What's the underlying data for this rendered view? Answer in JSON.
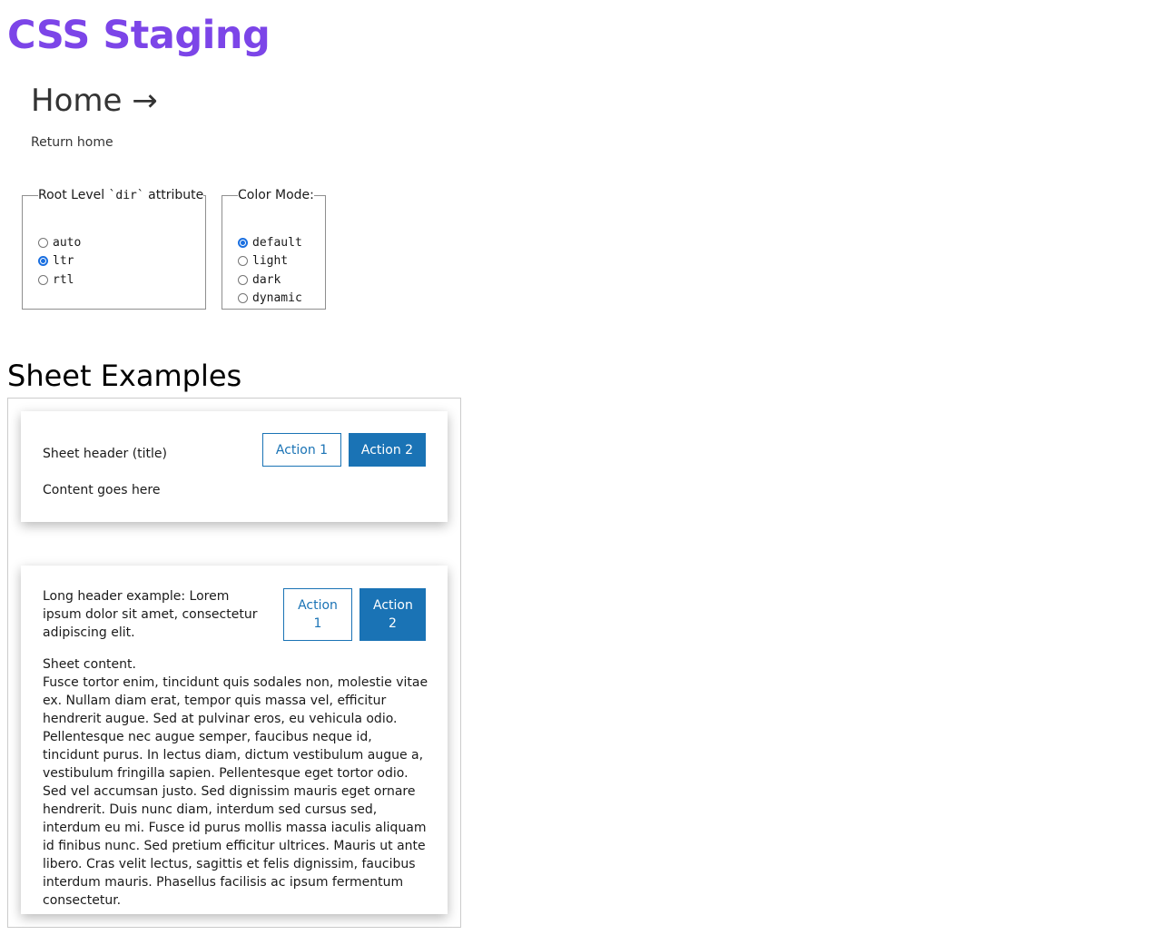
{
  "site": {
    "title": "CSS Staging"
  },
  "nav": {
    "heading": "Home →",
    "return_link": "Return home"
  },
  "dir_fieldset": {
    "legend_prefix": "Root Level ",
    "legend_code": "`dir`",
    "legend_suffix": " attribute",
    "options": [
      "auto",
      "ltr",
      "rtl"
    ],
    "selected": "ltr"
  },
  "color_fieldset": {
    "legend": "Color Mode:",
    "options": [
      "default",
      "light",
      "dark",
      "dynamic"
    ],
    "selected": "default"
  },
  "section": {
    "heading": "Sheet Examples"
  },
  "sheet1": {
    "title": "Sheet header (title)",
    "action1": "Action 1",
    "action2": "Action 2",
    "content": "Content goes here"
  },
  "sheet2": {
    "title": "Long header example: Lorem ipsum dolor sit amet, consectetur adipiscing elit.",
    "action1": "Action 1",
    "action2": "Action 2",
    "content_heading": "Sheet content.",
    "content_body": "Fusce tortor enim, tincidunt quis sodales non, molestie vitae ex. Nullam diam erat, tempor quis massa vel, efficitur hendrerit augue. Sed at pulvinar eros, eu vehicula odio. Pellentesque nec augue semper, faucibus neque id, tincidunt purus. In lectus diam, dictum vestibulum augue a, vestibulum fringilla sapien. Pellentesque eget tortor odio. Sed vel accumsan justo. Sed dignissim mauris eget ornare hendrerit. Duis nunc diam, interdum sed cursus sed, interdum eu mi. Fusce id purus mollis massa iaculis aliquam id finibus nunc. Sed pretium efficitur ultrices. Mauris ut ante libero. Cras velit lectus, sagittis et felis dignissim, faucibus interdum mauris. Phasellus facilisis ac ipsum fermentum consectetur."
  },
  "colors": {
    "brand": "#7c45e8",
    "button_primary": "#1a73b5",
    "radio_checked": "#1a6fe0"
  }
}
